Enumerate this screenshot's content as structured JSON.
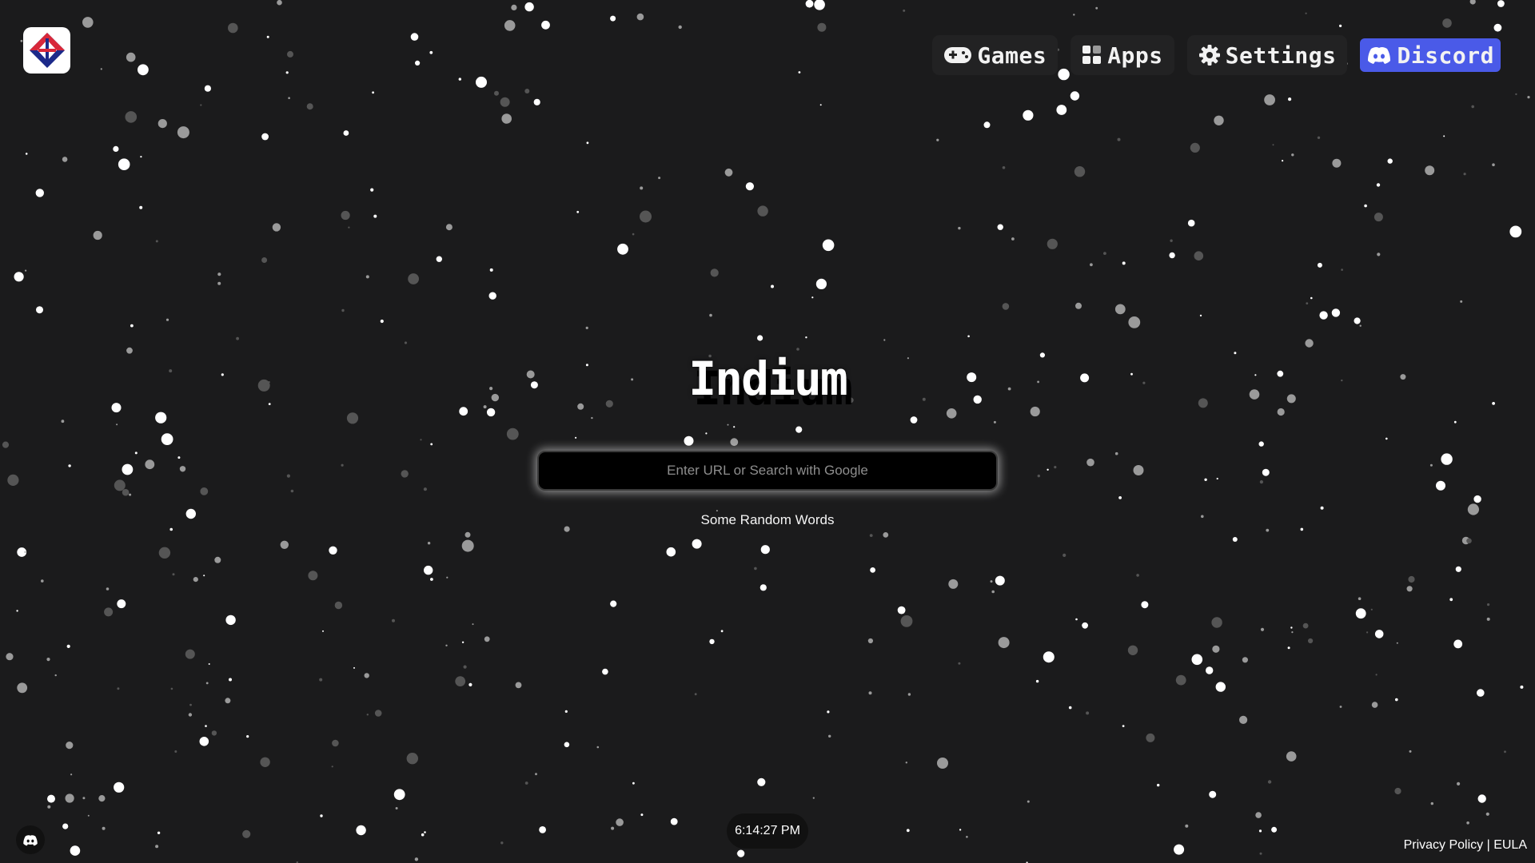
{
  "brand": {
    "title": "Indium"
  },
  "nav": [
    {
      "label": "Games",
      "icon": "gamepad-icon"
    },
    {
      "label": "Apps",
      "icon": "apps-grid-icon"
    },
    {
      "label": "Settings",
      "icon": "gear-icon"
    },
    {
      "label": "Discord",
      "icon": "discord-icon"
    }
  ],
  "search": {
    "placeholder": "Enter URL or Search with Google",
    "value": ""
  },
  "subtitle": "Some Random Words",
  "clock": "6:14:27 PM",
  "footer": {
    "privacy": "Privacy Policy",
    "separator": "|",
    "eula": "EULA"
  },
  "colors": {
    "background": "#1b1b1c",
    "discord": "#4a5ae8",
    "logo_red": "#d8283a",
    "logo_blue": "#1c2a8a"
  }
}
